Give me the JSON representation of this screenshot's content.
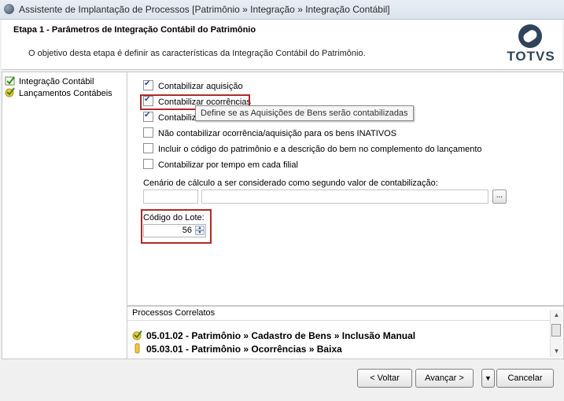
{
  "window": {
    "title": "Assistente de Implantação de Processos [Patrimônio » Integração » Integração Contábil]"
  },
  "header": {
    "step_title": "Etapa 1 - Parâmetros de Integração Contábil do Patrimônio",
    "description": "O objetivo desta etapa é definir as características da Integração Contábil do Patrimônio.",
    "logo_text": "TOTVS"
  },
  "sidebar": {
    "items": [
      {
        "label": "Integração Contábil",
        "icon": "checklist-icon"
      },
      {
        "label": "Lançamentos Contábeis",
        "icon": "checklist-icon"
      }
    ]
  },
  "options": {
    "items": [
      {
        "label": "Contabilizar aquisição",
        "checked": true
      },
      {
        "label": "Contabilizar ocorrências",
        "checked": true
      },
      {
        "label": "Contabiliz",
        "checked": true
      },
      {
        "label": "Não contabilizar ocorrência/aquisição para os bens INATIVOS",
        "checked": false
      },
      {
        "label": "Incluir o código do patrimônio e a descrição do bem no complemento do lançamento",
        "checked": false
      },
      {
        "label": "Contabilizar por tempo em cada filial",
        "checked": false
      }
    ],
    "tooltip": "Define se as Aquisições de Bens serão contabilizadas"
  },
  "scenario": {
    "label": "Cenário de cálculo a ser considerado como segundo valor de contabilização:",
    "code_value": "",
    "description_value": "",
    "lookup_label": "..."
  },
  "lot": {
    "label": "Código do Lote:",
    "value": "56"
  },
  "related": {
    "header": "Processos Correlatos",
    "rows": [
      {
        "text": "05.01.02 - Patrimônio » Cadastro de Bens » Inclusão Manual"
      },
      {
        "text": "05.03.01 - Patrimônio » Ocorrências » Baixa"
      }
    ]
  },
  "footer": {
    "back_label": "< Voltar",
    "next_label": "Avançar >",
    "menu_label": "▼",
    "cancel_label": "Cancelar"
  },
  "colors": {
    "highlight": "#b02a2a",
    "check": "#1f4a9a",
    "logo": "#2f4458"
  }
}
